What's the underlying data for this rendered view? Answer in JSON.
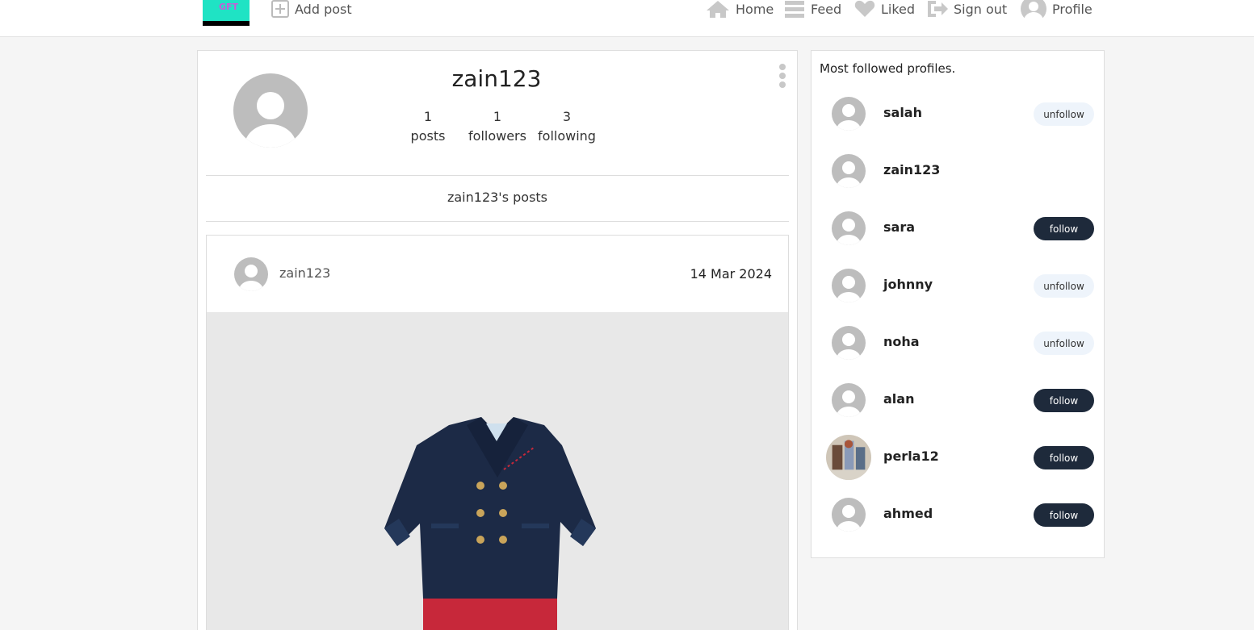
{
  "logo": {
    "text": "GFT"
  },
  "nav": {
    "add_post": "Add post",
    "home": "Home",
    "feed": "Feed",
    "liked": "Liked",
    "sign_out": "Sign out",
    "profile": "Profile"
  },
  "profile": {
    "username": "zain123",
    "stats": [
      {
        "value": "1",
        "label": "posts"
      },
      {
        "value": "1",
        "label": "followers"
      },
      {
        "value": "3",
        "label": "following"
      }
    ],
    "posts_title": "zain123's posts"
  },
  "post": {
    "author": "zain123",
    "date": "14 Mar 2024"
  },
  "sidebar": {
    "title": "Most followed profiles.",
    "profiles": [
      {
        "name": "salah",
        "action": "unfollow"
      },
      {
        "name": "zain123",
        "action": ""
      },
      {
        "name": "sara",
        "action": "follow"
      },
      {
        "name": "johnny",
        "action": "unfollow"
      },
      {
        "name": "noha",
        "action": "unfollow"
      },
      {
        "name": "alan",
        "action": "follow"
      },
      {
        "name": "perla12",
        "action": "follow"
      },
      {
        "name": "ahmed",
        "action": "follow"
      }
    ]
  },
  "colors": {
    "accent_dark": "#1e2a3b",
    "unfollow_bg": "#eef4fb",
    "logo_bg": "#1fe3c4"
  }
}
